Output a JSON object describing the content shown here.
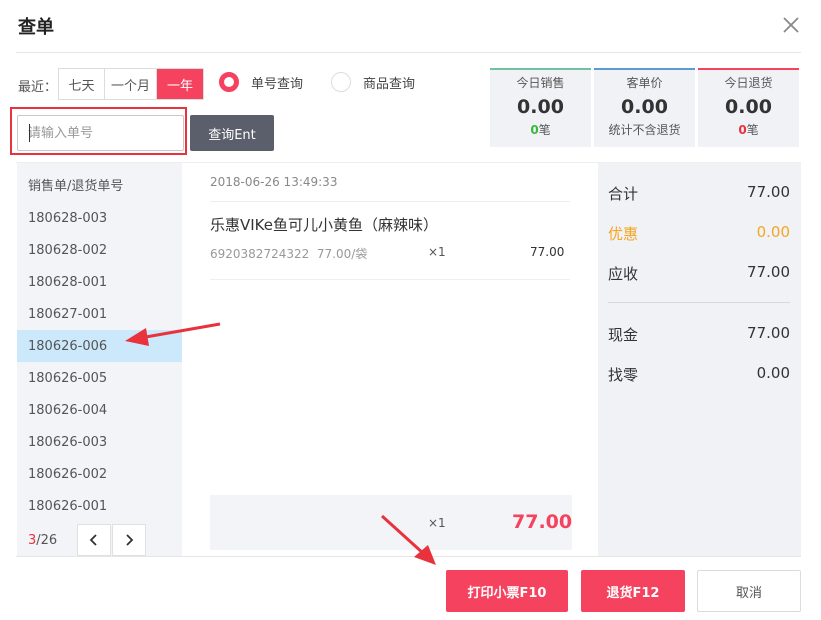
{
  "dialog": {
    "title": "查单"
  },
  "filter": {
    "recent_label": "最近：",
    "ranges": [
      "七天",
      "一个月",
      "一年"
    ],
    "active_range": "一年",
    "radio_order": "单号查询",
    "radio_product": "商品查询",
    "selected_mode": "单号查询",
    "search_placeholder": "请输入单号",
    "search_button": "查询Ent"
  },
  "stats": [
    {
      "label": "今日销售",
      "value": "0.00",
      "count": "0",
      "suffix": "笔",
      "color": "#6fc2a0"
    },
    {
      "label": "客单价",
      "value": "0.00",
      "note": "统计不含退货",
      "color": "#5b9bd5"
    },
    {
      "label": "今日退货",
      "value": "0.00",
      "count": "0",
      "suffix": "笔",
      "color": "#f5425e"
    }
  ],
  "order_list": {
    "header": "销售单/退货单号",
    "items": [
      "180628-003",
      "180628-002",
      "180628-001",
      "180627-001",
      "180626-006",
      "180626-005",
      "180626-004",
      "180626-003",
      "180626-002",
      "180626-001"
    ],
    "selected": "180626-006",
    "pager": {
      "current": "3",
      "total": "/26"
    }
  },
  "detail": {
    "time": "2018-06-26 13:49:33",
    "product": {
      "name": "乐惠VIKe鱼可儿小黄鱼（麻辣味）",
      "code": "6920382724322",
      "price": "77.00/袋",
      "qty": "×1",
      "amount": "77.00"
    },
    "footer": {
      "qty": "×1",
      "total": "77.00"
    }
  },
  "summary": {
    "total_label": "合计",
    "total_value": "77.00",
    "discount_label": "优惠",
    "discount_value": "0.00",
    "receivable_label": "应收",
    "receivable_value": "77.00",
    "cash_label": "现金",
    "cash_value": "77.00",
    "change_label": "找零",
    "change_value": "0.00"
  },
  "actions": {
    "print": "打印小票F10",
    "refund": "退货F12",
    "cancel": "取消"
  },
  "colors": {
    "accent": "#f5425e",
    "selected_row": "#cce8fb",
    "query_button": "#5b5f6b",
    "annotation_red": "#e8323c"
  }
}
